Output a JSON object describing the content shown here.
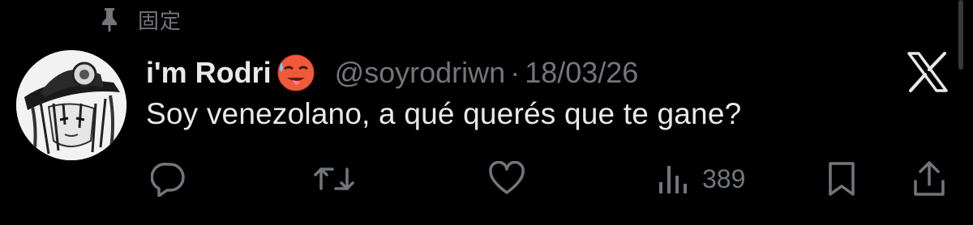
{
  "pinned": {
    "label": "固定",
    "icon": "pin-icon"
  },
  "tweet": {
    "display_name": "i'm Rodri",
    "name_emoji": "hot-face-emoji",
    "handle": "@soyrodriwn",
    "separator": "·",
    "date": "18/03/26",
    "text": "Soy venezolano, a qué querés que te gane?"
  },
  "actions": {
    "reply_icon": "reply-icon",
    "retweet_icon": "retweet-icon",
    "like_icon": "heart-icon",
    "views_icon": "views-icon",
    "views_count": "389",
    "bookmark_icon": "bookmark-icon",
    "share_icon": "share-icon"
  },
  "branding": {
    "logo": "x-logo-icon"
  },
  "colors": {
    "background": "#000000",
    "primary_text": "#e7e9ea",
    "secondary_text": "#71767b"
  }
}
